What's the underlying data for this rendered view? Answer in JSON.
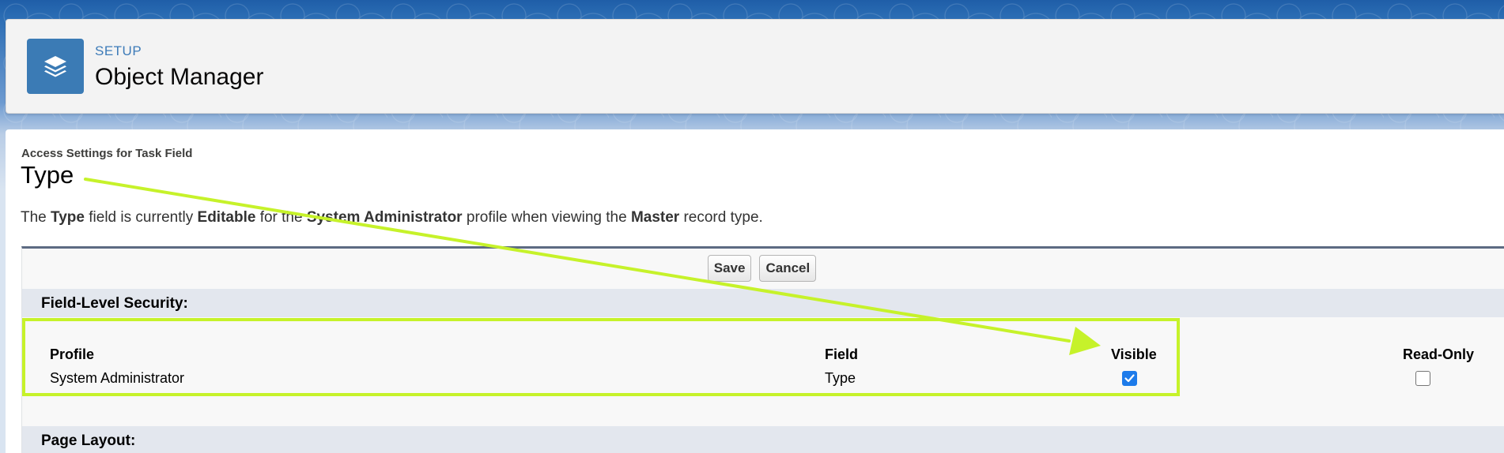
{
  "header": {
    "app_icon": "layers-icon",
    "setup_label": "SETUP",
    "title": "Object Manager"
  },
  "content": {
    "access_label": "Access Settings for Task Field",
    "field_title": "Type",
    "description": {
      "p1": "The ",
      "field": "Type",
      "p2": " field is currently ",
      "access": "Editable",
      "p3": " for the ",
      "profile": "System Administrator",
      "p4": " profile when viewing the ",
      "record_type": "Master",
      "p5": " record type."
    },
    "buttons": {
      "save": "Save",
      "cancel": "Cancel"
    },
    "sections": {
      "field_level_security": "Field-Level Security:",
      "page_layout": "Page Layout:"
    },
    "table": {
      "columns": {
        "profile": "Profile",
        "field": "Field",
        "visible": "Visible",
        "read_only": "Read-Only"
      },
      "row": {
        "profile": "System Administrator",
        "field": "Type",
        "visible": true,
        "read_only": false
      }
    }
  },
  "annotation": {
    "color": "#c6f22a"
  },
  "colors": {
    "brand_blue": "#3b7bb5",
    "checkbox_blue": "#1d7bea"
  }
}
